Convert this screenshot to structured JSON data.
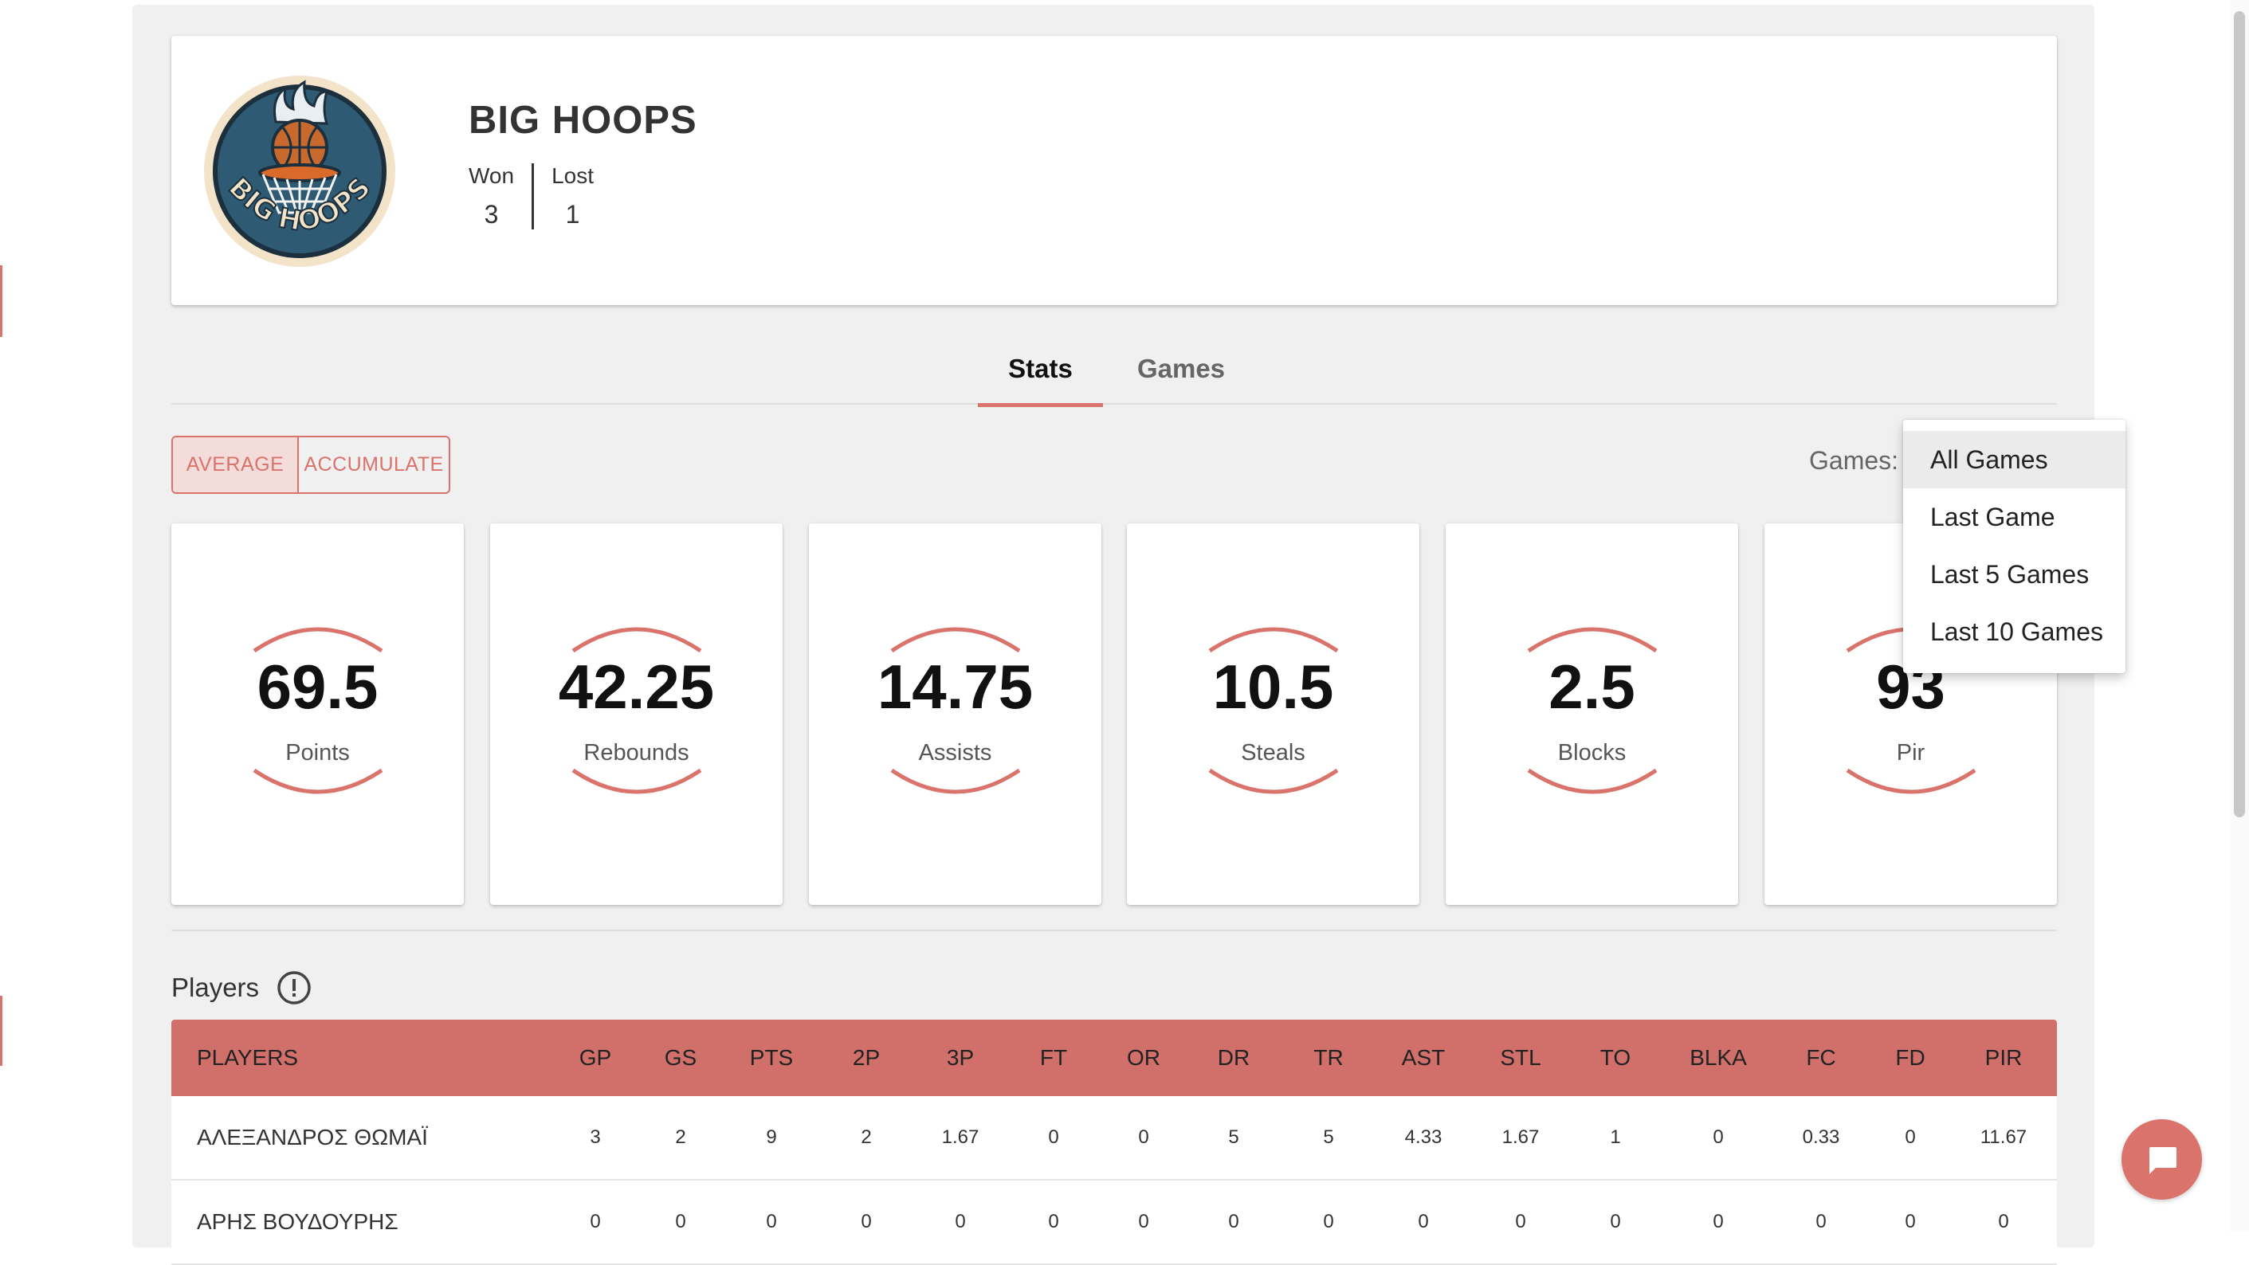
{
  "team": {
    "name": "BIG HOOPS",
    "logo_text": "BIG HOOPS",
    "won_label": "Won",
    "won_value": "3",
    "lost_label": "Lost",
    "lost_value": "1"
  },
  "tabs": [
    {
      "label": "Stats",
      "active": true
    },
    {
      "label": "Games",
      "active": false
    }
  ],
  "mode_toggle": {
    "average_label": "AVERAGE",
    "accumulate_label": "ACCUMULATE",
    "selected": "AVERAGE"
  },
  "games_filter": {
    "label": "Games:",
    "options": [
      "All Games",
      "Last Game",
      "Last 5 Games",
      "Last 10 Games"
    ],
    "selected": "All Games"
  },
  "stat_cards": [
    {
      "value": "69.5",
      "label": "Points"
    },
    {
      "value": "42.25",
      "label": "Rebounds"
    },
    {
      "value": "14.75",
      "label": "Assists"
    },
    {
      "value": "10.5",
      "label": "Steals"
    },
    {
      "value": "2.5",
      "label": "Blocks"
    },
    {
      "value": "93",
      "label": "Pir"
    }
  ],
  "players": {
    "title": "Players",
    "info_icon": "info-circle-icon",
    "columns": [
      "PLAYERS",
      "GP",
      "GS",
      "PTS",
      "2P",
      "3P",
      "FT",
      "OR",
      "DR",
      "TR",
      "AST",
      "STL",
      "TO",
      "BLKA",
      "FC",
      "FD",
      "PIR"
    ],
    "rows": [
      [
        "ΑΛΕΞΑΝΔΡΟΣ ΘΩΜΑΪ",
        "3",
        "2",
        "9",
        "2",
        "1.67",
        "0",
        "0",
        "5",
        "5",
        "4.33",
        "1.67",
        "1",
        "0",
        "0.33",
        "0",
        "11.67"
      ],
      [
        "ΑΡΗΣ ΒΟΥΔΟΥΡΗΣ",
        "0",
        "0",
        "0",
        "0",
        "0",
        "0",
        "0",
        "0",
        "0",
        "0",
        "0",
        "0",
        "0",
        "0",
        "0",
        "0"
      ]
    ]
  },
  "chat_button": {
    "icon": "chat-bubble-icon"
  },
  "colors": {
    "accent": "#d9736b",
    "header_bg": "#d1706a",
    "panel_bg": "#f0f0f0"
  }
}
